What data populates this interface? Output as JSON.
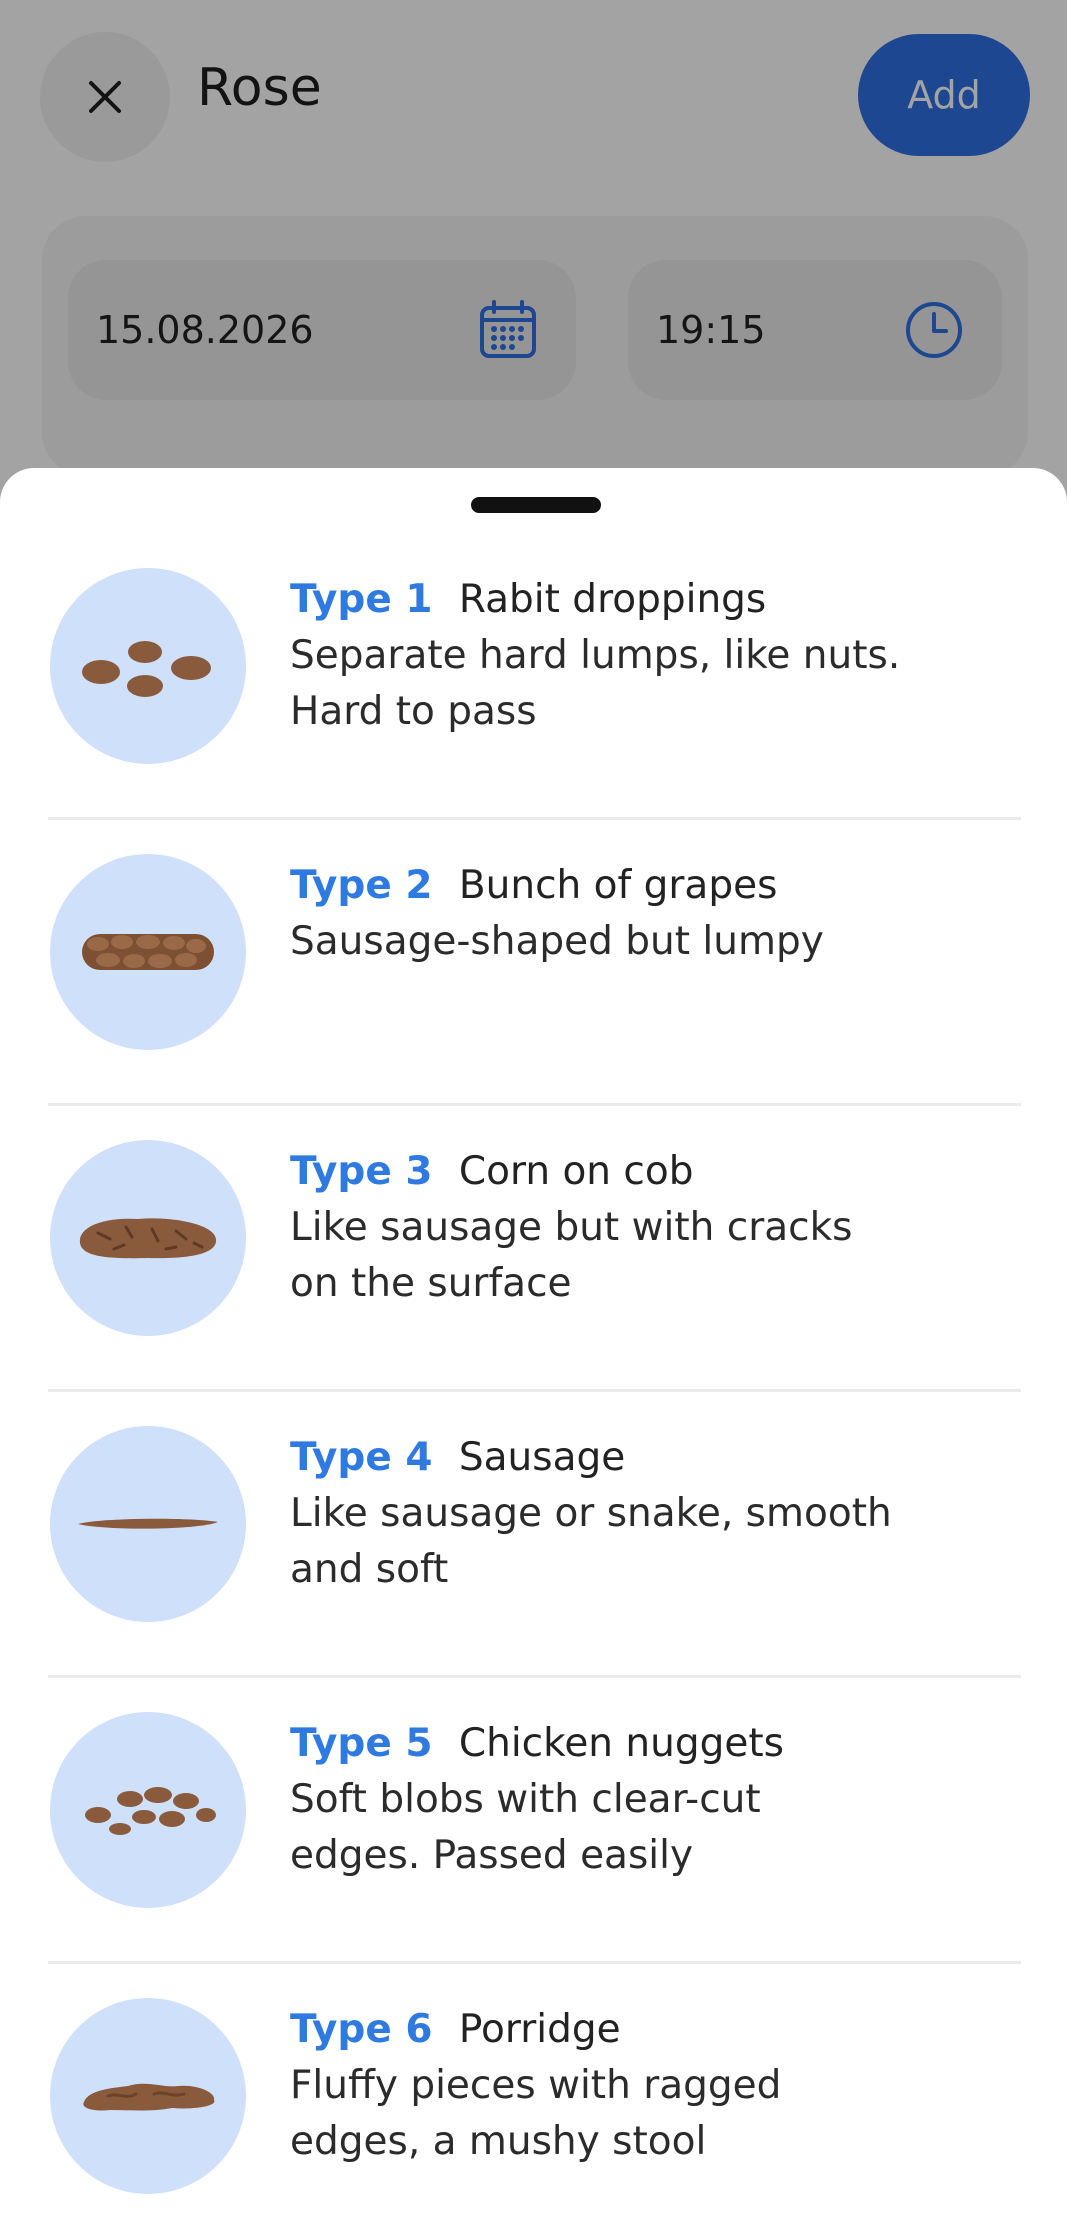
{
  "header": {
    "title": "Rose",
    "add_label": "Add"
  },
  "form": {
    "date": "15.08.2026",
    "time": "19:15"
  },
  "colors": {
    "accent": "#2f6fe5",
    "type_label": "#2f7ae0",
    "thumb_bg": "#cfe0fb",
    "stool": "#8a5a3c"
  },
  "types": [
    {
      "label": "Type 1",
      "name": "Rabit droppings",
      "desc1": "Separate hard lumps, like nuts.",
      "desc2": "Hard to pass"
    },
    {
      "label": "Type 2",
      "name": "Bunch of grapes",
      "desc1": "Sausage-shaped but lumpy",
      "desc2": ""
    },
    {
      "label": "Type 3",
      "name": "Corn on cob",
      "desc1": "Like sausage but with cracks",
      "desc2": "on the surface"
    },
    {
      "label": "Type 4",
      "name": "Sausage",
      "desc1": "Like sausage or snake, smooth",
      "desc2": "and soft"
    },
    {
      "label": "Type 5",
      "name": "Chicken nuggets",
      "desc1": "Soft blobs with clear-cut",
      "desc2": "edges. Passed easily"
    },
    {
      "label": "Type 6",
      "name": "Porridge",
      "desc1": "Fluffy pieces with ragged",
      "desc2": "edges, a mushy stool"
    }
  ]
}
